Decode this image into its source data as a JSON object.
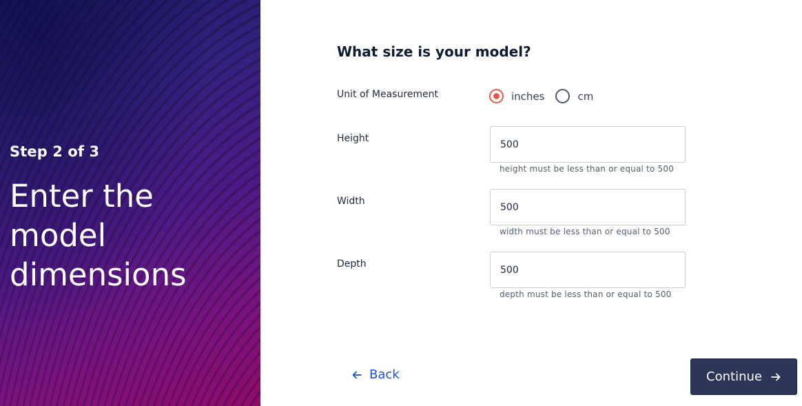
{
  "hero": {
    "step": "Step 2 of 3",
    "title": "Enter the model dimensions"
  },
  "form": {
    "title": "What size is your model?",
    "unit": {
      "label": "Unit of Measurement",
      "options": [
        "inches",
        "cm"
      ],
      "selected": "inches"
    },
    "height": {
      "label": "Height",
      "value": "500",
      "hint": "height must be less than or equal to 500"
    },
    "width": {
      "label": "Width",
      "value": "500",
      "hint": "width must be less than or equal to 500"
    },
    "depth": {
      "label": "Depth",
      "value": "500",
      "hint": "depth must be less than or equal to 500"
    }
  },
  "nav": {
    "back_label": "Back",
    "continue_label": "Continue"
  },
  "colors": {
    "accent_radio": "#e4594b",
    "link": "#1d4fd8",
    "primary_button": "#2d3656"
  },
  "icons": {
    "back": "arrow-left-icon",
    "continue": "arrow-right-icon"
  }
}
